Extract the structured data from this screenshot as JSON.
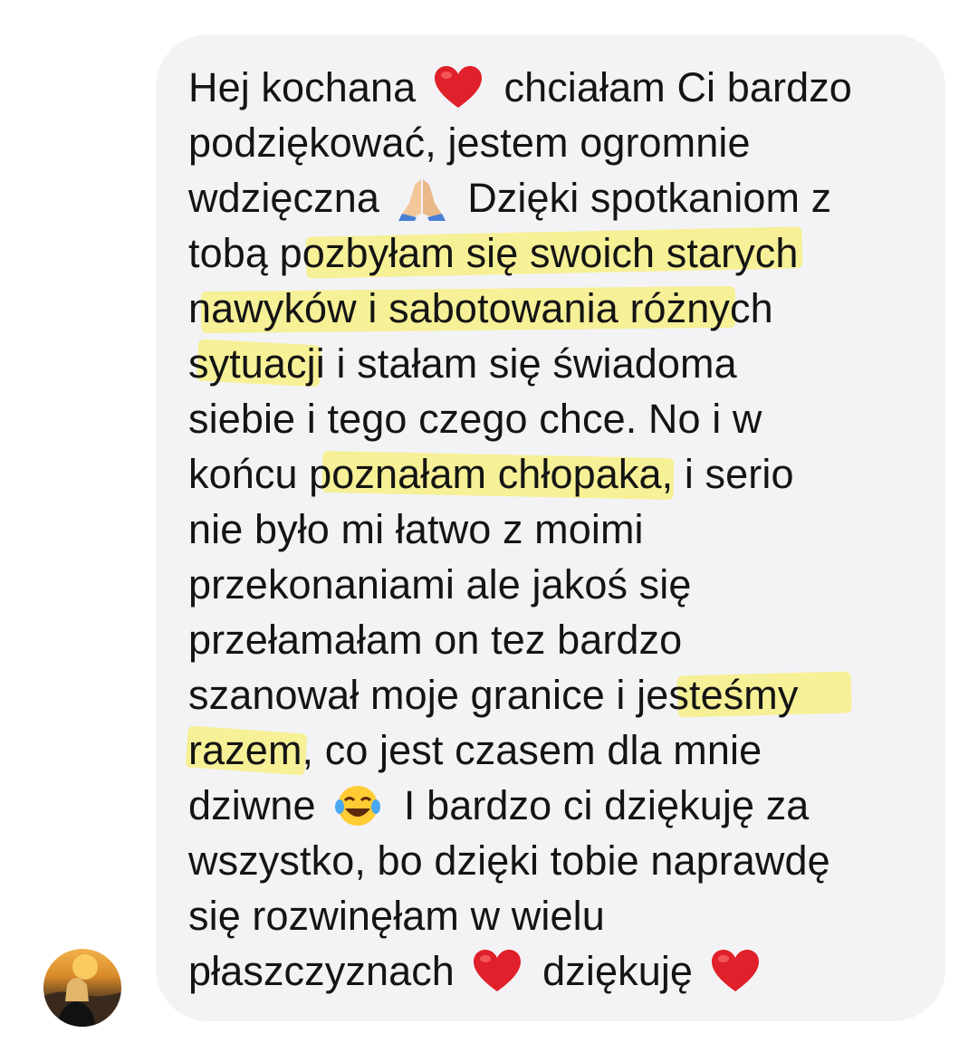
{
  "message": {
    "lines": [
      [
        "Hej kochana ",
        "heart",
        " chciałam Ci bardzo"
      ],
      [
        "podziękować, jestem ogromnie"
      ],
      [
        "wdzięczna ",
        "pray",
        " Dzięki spotkaniom z"
      ],
      [
        "tobą pozbyłam się swoich starych"
      ],
      [
        "nawyków i sabotowania różnych"
      ],
      [
        "sytuacji i stałam się świadoma"
      ],
      [
        "siebie i tego czego chce. No i w"
      ],
      [
        "końcu poznałam chłopaka, i serio"
      ],
      [
        "nie było mi łatwo z moimi"
      ],
      [
        "przekonaniami ale jakoś się"
      ],
      [
        "przełamałam on tez bardzo"
      ],
      [
        "szanował moje granice i jesteśmy"
      ],
      [
        "razem, co jest czasem dla mnie"
      ],
      [
        "dziwne ",
        "joy",
        " I bardzo ci dziękuję za"
      ],
      [
        "wszystko, bo dzięki tobie naprawdę"
      ],
      [
        "się rozwinęłam w wielu"
      ],
      [
        "płaszczyznach ",
        "heart",
        " dziękuję ",
        "heart"
      ]
    ]
  },
  "icons": {
    "heart": "red-heart-icon",
    "pray": "praying-hands-icon",
    "joy": "tears-of-joy-face-icon"
  },
  "colors": {
    "bubble": "#f3f3f6",
    "text": "#141414",
    "highlight": "#f6ee86",
    "heart": "#e0202a"
  },
  "avatar": {
    "icon": "avatar-photo"
  }
}
